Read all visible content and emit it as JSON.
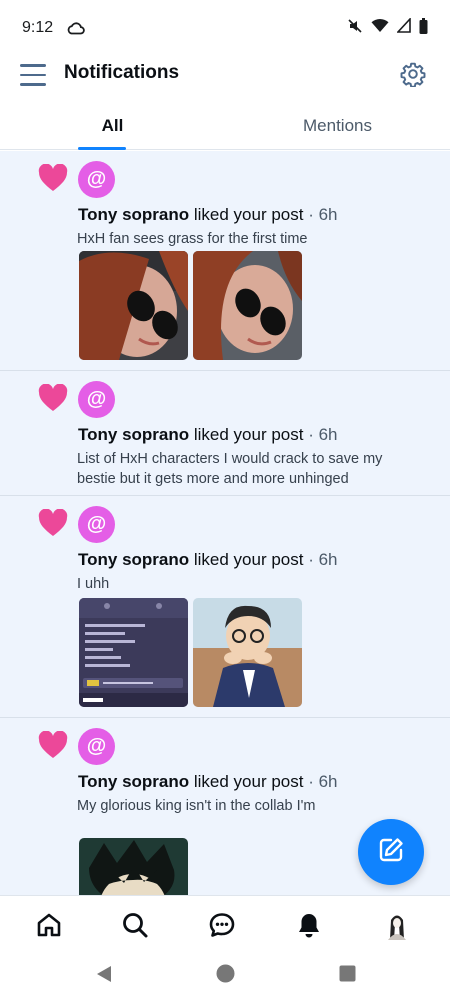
{
  "status_bar": {
    "time": "9:12",
    "icons": [
      "cloud-icon",
      "mute-icon",
      "wifi-icon",
      "signal-icon",
      "battery-icon"
    ]
  },
  "header": {
    "title": "Notifications",
    "menu_icon": "hamburger-icon",
    "settings_icon": "gear-icon"
  },
  "tabs": [
    {
      "label": "All",
      "active": true
    },
    {
      "label": "Mentions",
      "active": false
    }
  ],
  "notifications": [
    {
      "icon": "heart-icon",
      "avatar_glyph": "@",
      "user": "Tony soprano",
      "action": " liked your post",
      "time": " · 6h",
      "post_text": "HxH fan sees grass for the first time",
      "images": 2
    },
    {
      "icon": "heart-icon",
      "avatar_glyph": "@",
      "user": "Tony soprano",
      "action": " liked your post",
      "time": " · 6h",
      "post_text": "List of HxH characters I would crack to save my bestie but it gets more and more unhinged",
      "images": 0
    },
    {
      "icon": "heart-icon",
      "avatar_glyph": "@",
      "user": "Tony soprano",
      "action": " liked your post",
      "time": " · 6h",
      "post_text": "I uhh",
      "images": 2
    },
    {
      "icon": "heart-icon",
      "avatar_glyph": "@",
      "user": "Tony soprano",
      "action": " liked your post",
      "time": " · 6h",
      "post_text": "My glorious king isn't in the collab I'm",
      "images": 1
    }
  ],
  "compose_button": {
    "icon": "compose-icon"
  },
  "bottom_nav": [
    {
      "name": "home",
      "icon": "home-icon"
    },
    {
      "name": "search",
      "icon": "search-icon"
    },
    {
      "name": "chat",
      "icon": "chat-icon"
    },
    {
      "name": "notifications",
      "icon": "bell-icon",
      "active": true
    },
    {
      "name": "profile",
      "icon": "avatar"
    }
  ],
  "system_nav": [
    "back-icon",
    "home-circle-icon",
    "recents-icon"
  ],
  "colors": {
    "accent": "#1083fe",
    "heart": "#ec4899",
    "avatar_bg": "#e45ee6",
    "unread_bg": "#eef4fd",
    "menu_icon": "#4d6a8c"
  }
}
